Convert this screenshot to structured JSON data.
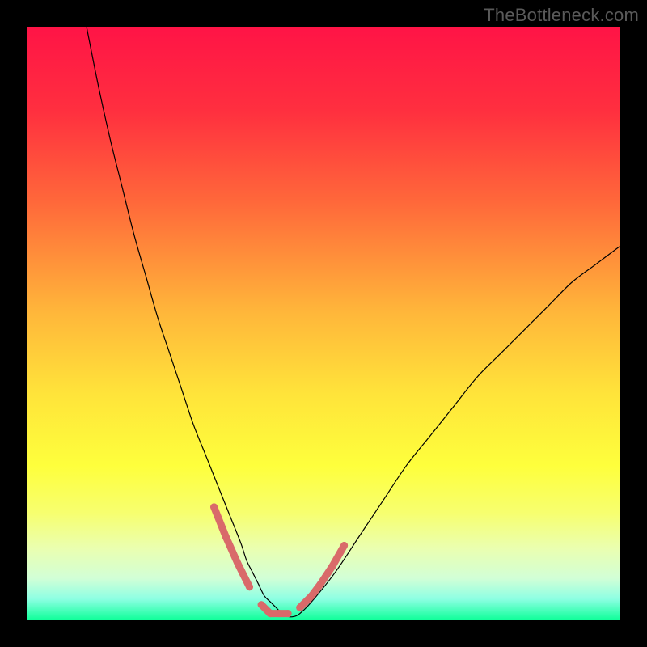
{
  "watermark": "TheBottleneck.com",
  "chart_data": {
    "type": "line",
    "title": "",
    "xlabel": "",
    "ylabel": "",
    "xlim": [
      0,
      100
    ],
    "ylim": [
      0,
      100
    ],
    "grid": false,
    "legend": false,
    "gradient_stops": [
      {
        "offset": 0,
        "color": "#ff1446"
      },
      {
        "offset": 0.14,
        "color": "#ff2f3f"
      },
      {
        "offset": 0.3,
        "color": "#ff6a3a"
      },
      {
        "offset": 0.48,
        "color": "#ffb63a"
      },
      {
        "offset": 0.62,
        "color": "#ffe43a"
      },
      {
        "offset": 0.74,
        "color": "#feff3c"
      },
      {
        "offset": 0.82,
        "color": "#f7ff6f"
      },
      {
        "offset": 0.88,
        "color": "#eaffb0"
      },
      {
        "offset": 0.93,
        "color": "#d2ffd6"
      },
      {
        "offset": 0.965,
        "color": "#8effe3"
      },
      {
        "offset": 1.0,
        "color": "#12ff9b"
      }
    ],
    "series": [
      {
        "name": "bottleneck-curve",
        "color": "#000000",
        "width": 1.2,
        "x": [
          10,
          12,
          14,
          16,
          18,
          20,
          22,
          24,
          26,
          28,
          30,
          32,
          34,
          36,
          37,
          38,
          39,
          40,
          41,
          42,
          43,
          44,
          45,
          46,
          48,
          52,
          56,
          60,
          64,
          68,
          72,
          76,
          80,
          84,
          88,
          92,
          96,
          100
        ],
        "y": [
          100,
          90,
          81,
          73,
          65,
          58,
          51,
          45,
          39,
          33,
          28,
          23,
          18,
          13,
          10,
          8,
          6,
          4,
          3,
          2,
          1,
          0.5,
          0.5,
          1,
          3,
          8,
          14,
          20,
          26,
          31,
          36,
          41,
          45,
          49,
          53,
          57,
          60,
          63
        ]
      },
      {
        "name": "corridor-markers",
        "color": "#d96a6a",
        "type": "scatter",
        "stroke_width": 9,
        "x": [
          31.5,
          33.5,
          35.5,
          37.5,
          39.5,
          41.0,
          42.5,
          44.0,
          46.0,
          48.0,
          49.5,
          51.5,
          53.5
        ],
        "y": [
          19.0,
          14.0,
          9.5,
          5.5,
          2.5,
          1.0,
          1.0,
          1.0,
          2.0,
          4.0,
          6.0,
          9.0,
          12.5
        ]
      }
    ],
    "green_band": {
      "y0": 0,
      "y1": 4,
      "color_top": "#8cffd6",
      "color_bottom": "#10ff9a"
    }
  }
}
